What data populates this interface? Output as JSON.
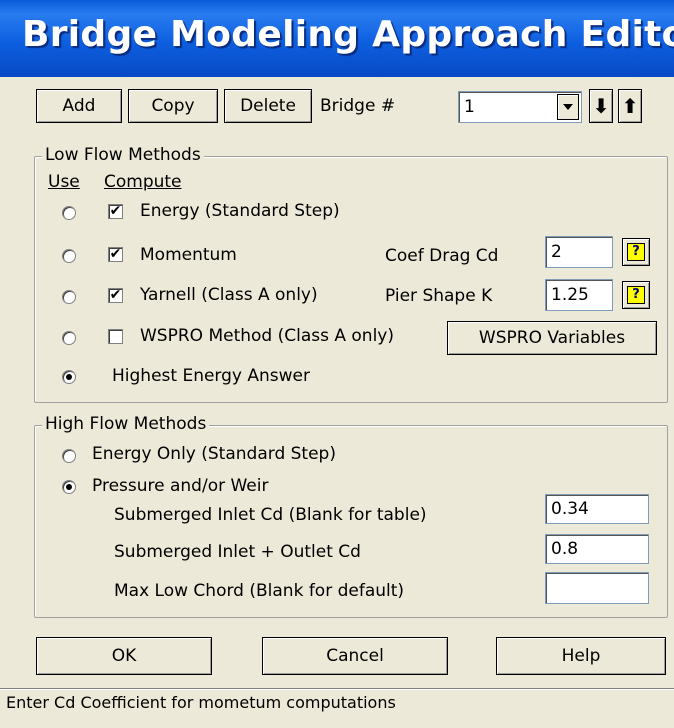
{
  "window": {
    "title": "Bridge Modeling Approach Editor"
  },
  "toolbar": {
    "add_label": "Add",
    "copy_label": "Copy",
    "delete_label": "Delete",
    "bridge_label": "Bridge #",
    "bridge_value": "1",
    "down_arrow": "⬇",
    "up_arrow": "⬆"
  },
  "low_flow": {
    "title": "Low Flow Methods",
    "use_header": "Use",
    "compute_header": "Compute",
    "methods": [
      {
        "label": "Energy (Standard Step)",
        "use_selected": false,
        "compute_checked": true
      },
      {
        "label": "Momentum",
        "use_selected": false,
        "compute_checked": true
      },
      {
        "label": "Yarnell (Class A only)",
        "use_selected": false,
        "compute_checked": true
      },
      {
        "label": "WSPRO Method (Class A only)",
        "use_selected": false,
        "compute_checked": false
      }
    ],
    "highest_energy": {
      "label": "Highest Energy Answer",
      "selected": true
    },
    "coef_drag_label": "Coef Drag Cd",
    "coef_drag_value": "2",
    "pier_shape_label": "Pier Shape K",
    "pier_shape_value": "1.25",
    "wspro_button": "WSPRO Variables",
    "help_glyph": "?"
  },
  "high_flow": {
    "title": "High Flow Methods",
    "energy_only": {
      "label": "Energy Only (Standard Step)",
      "selected": false
    },
    "pressure_weir": {
      "label": "Pressure and/or Weir",
      "selected": true
    },
    "submerged_inlet_label": "Submerged Inlet Cd (Blank for table)",
    "submerged_inlet_value": "0.34",
    "submerged_outlet_label": "Submerged Inlet + Outlet Cd",
    "submerged_outlet_value": "0.8",
    "max_low_chord_label": "Max Low Chord (Blank for default)",
    "max_low_chord_value": ""
  },
  "footer": {
    "ok_label": "OK",
    "cancel_label": "Cancel",
    "help_label": "Help"
  },
  "status": {
    "text": "Enter Cd Coefficient for mometum computations"
  }
}
